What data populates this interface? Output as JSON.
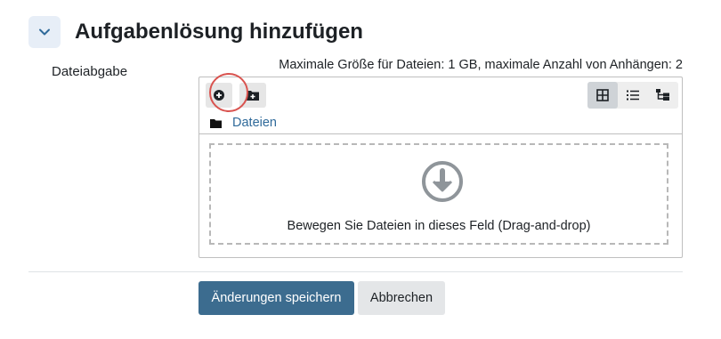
{
  "section": {
    "title": "Aufgabenlösung hinzufügen",
    "collapse_icon": "chevron-down-icon"
  },
  "field": {
    "label": "Dateiabgabe",
    "max_info": "Maximale Größe für Dateien: 1 GB, maximale Anzahl von Anhängen: 2"
  },
  "filemanager": {
    "toolbar": {
      "add_icon": "add-file-icon",
      "new_folder_icon": "create-folder-icon",
      "views": [
        {
          "icon": "grid-view-icon",
          "active": true
        },
        {
          "icon": "list-view-icon",
          "active": false
        },
        {
          "icon": "tree-view-icon",
          "active": false
        }
      ]
    },
    "path": {
      "folder_icon": "folder-icon",
      "label": "Dateien"
    },
    "dropzone": {
      "icon": "download-arrow-icon",
      "text": "Bewegen Sie Dateien in dieses Feld (Drag-and-drop)"
    }
  },
  "actions": {
    "save_label": "Änderungen speichern",
    "cancel_label": "Abbrechen"
  },
  "colors": {
    "primary": "#3c6c8f",
    "link": "#2f6a9a",
    "highlight_ring": "#d9534f"
  }
}
